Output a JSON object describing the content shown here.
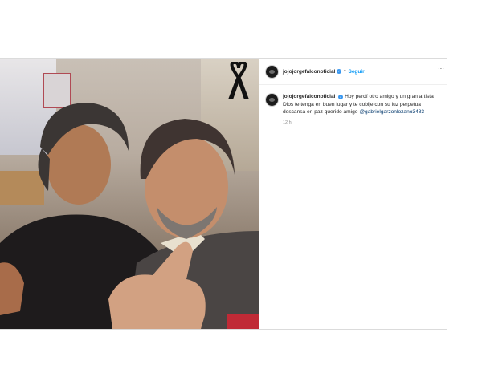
{
  "post": {
    "username": "jojojorgefalconoficial",
    "verified_icon": "verified-badge-icon",
    "follow_label": "Seguir",
    "more_icon": "more-options-icon",
    "caption": {
      "username": "jojojorgefalconoficial",
      "text": "Hoy perdí otro amigo y un gran artista Dios te tenga en buen lugar y te cobije con su luz perpetua descansa en paz querido amigo",
      "mention": "@gabrielgarzonlozano3483",
      "time": "12 h"
    },
    "photo": {
      "description_icon": "mourning-ribbon-icon"
    },
    "colors": {
      "accent": "#0095f6",
      "verified": "#3897f0",
      "mention": "#00376b",
      "muted": "#8e8e8e"
    }
  }
}
